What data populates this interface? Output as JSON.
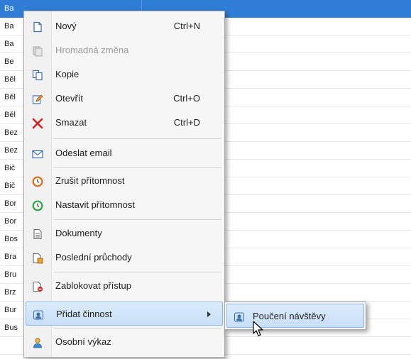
{
  "grid": {
    "rows": [
      {
        "name": "Ba",
        "selected": true
      },
      {
        "name": "Ba",
        "selected": false
      },
      {
        "name": "Ba",
        "selected": false
      },
      {
        "name": "Be",
        "selected": false
      },
      {
        "name": "Běl",
        "selected": false
      },
      {
        "name": "Běl",
        "selected": false
      },
      {
        "name": "Běl",
        "selected": false
      },
      {
        "name": "Bez",
        "selected": false
      },
      {
        "name": "Bez",
        "selected": false
      },
      {
        "name": "Bič",
        "selected": false
      },
      {
        "name": "Bič",
        "selected": false
      },
      {
        "name": "Bor",
        "selected": false
      },
      {
        "name": "Bor",
        "selected": false
      },
      {
        "name": "Bos",
        "selected": false
      },
      {
        "name": "Bra",
        "selected": false
      },
      {
        "name": "Bru",
        "selected": false
      },
      {
        "name": "Brz",
        "selected": false
      },
      {
        "name": "Bur",
        "selected": false
      },
      {
        "name": "Bus",
        "selected": false
      }
    ]
  },
  "menu": {
    "items": [
      {
        "label": "Nový",
        "shortcut": "Ctrl+N",
        "icon": "new-document-icon"
      },
      {
        "label": "Hromadná změna",
        "shortcut": "",
        "icon": "bulk-change-icon",
        "disabled": true
      },
      {
        "label": "Kopie",
        "shortcut": "",
        "icon": "copy-icon"
      },
      {
        "label": "Otevřít",
        "shortcut": "Ctrl+O",
        "icon": "edit-pencil-icon"
      },
      {
        "label": "Smazat",
        "shortcut": "Ctrl+D",
        "icon": "delete-x-icon"
      },
      {
        "label": "Odeslat email",
        "shortcut": "",
        "icon": "envelope-icon"
      },
      {
        "label": "Zrušit přítomnost",
        "shortcut": "",
        "icon": "cancel-presence-icon"
      },
      {
        "label": "Nastavit přítomnost",
        "shortcut": "",
        "icon": "set-presence-icon"
      },
      {
        "label": "Dokumenty",
        "shortcut": "",
        "icon": "documents-icon"
      },
      {
        "label": "Poslední průchody",
        "shortcut": "",
        "icon": "last-passages-icon"
      },
      {
        "label": "Zablokovat přístup",
        "shortcut": "",
        "icon": "block-access-icon"
      },
      {
        "label": "Přidat činnost",
        "shortcut": "",
        "icon": "add-activity-icon",
        "hover": true,
        "submenu": true
      },
      {
        "label": "Osobní výkaz",
        "shortcut": "",
        "icon": "personal-report-icon"
      }
    ]
  },
  "submenu": {
    "items": [
      {
        "label": "Poučení návštěvy",
        "icon": "visitor-instruction-icon"
      }
    ]
  },
  "colors": {
    "selection": "#2f7dd6",
    "hover_bg": "#c7dff8",
    "delete_red": "#d42020"
  }
}
